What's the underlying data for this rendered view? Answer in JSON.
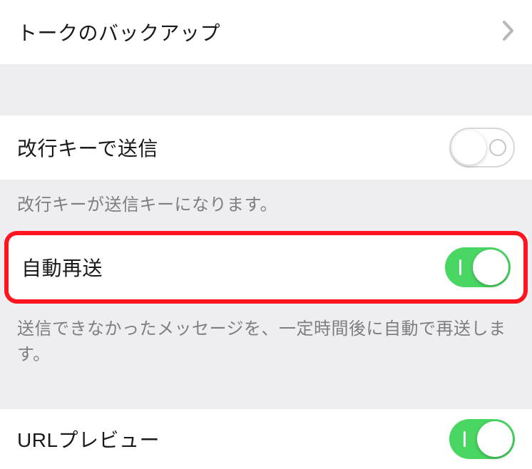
{
  "rows": {
    "backup": {
      "label": "トークのバックアップ"
    },
    "enter_send": {
      "label": "改行キーで送信",
      "description": "改行キーが送信キーになります。",
      "toggle": false
    },
    "auto_resend": {
      "label": "自動再送",
      "description": "送信できなかったメッセージを、一定時間後に自動で再送します。",
      "toggle": true
    },
    "url_preview": {
      "label": "URLプレビュー",
      "toggle": true
    }
  }
}
